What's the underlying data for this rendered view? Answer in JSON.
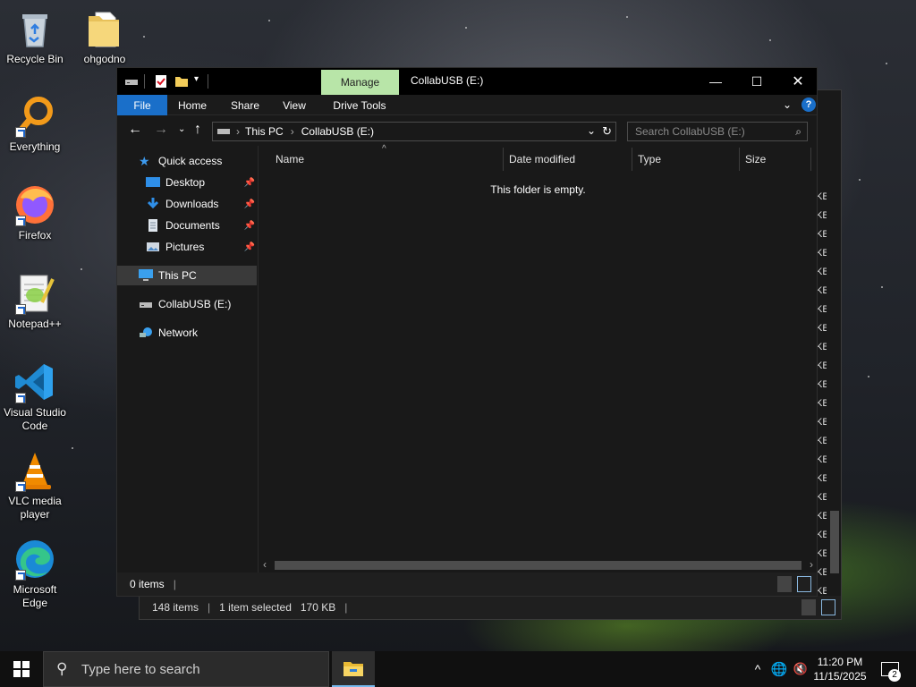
{
  "desktop": {
    "icons": [
      {
        "label": "Recycle Bin",
        "icon": "recycle-bin-icon"
      },
      {
        "label": "ohgodno",
        "icon": "folder-icon"
      },
      {
        "label": "Everything",
        "icon": "everything-search-icon"
      },
      {
        "label": "Firefox",
        "icon": "firefox-icon"
      },
      {
        "label": "Notepad++",
        "icon": "notepad-plus-plus-icon"
      },
      {
        "label": "Visual Studio Code",
        "icon": "vscode-icon"
      },
      {
        "label": "VLC media player",
        "icon": "vlc-icon"
      },
      {
        "label": "Microsoft Edge",
        "icon": "edge-icon"
      }
    ]
  },
  "background_window": {
    "status": {
      "items": "148 items",
      "selected": "1 item selected",
      "size": "170 KB"
    },
    "size_fragment": "KB"
  },
  "explorer": {
    "title": "CollabUSB (E:)",
    "contextual_tab": "Manage",
    "ribbon_tabs": [
      "File",
      "Home",
      "Share",
      "View",
      "Drive Tools"
    ],
    "breadcrumb": [
      "This PC",
      "CollabUSB (E:)"
    ],
    "search_placeholder": "Search CollabUSB (E:)",
    "nav": {
      "quick_access": "Quick access",
      "pinned": [
        "Desktop",
        "Downloads",
        "Documents",
        "Pictures"
      ],
      "this_pc": "This PC",
      "drive": "CollabUSB (E:)",
      "network": "Network"
    },
    "columns": [
      "Name",
      "Date modified",
      "Type",
      "Size"
    ],
    "empty_message": "This folder is empty.",
    "status": {
      "items": "0 items"
    }
  },
  "taskbar": {
    "search_placeholder": "Type here to search",
    "time": "11:20 PM",
    "date": "11/15/2025",
    "notifications": "2"
  },
  "colors": {
    "file_tab": "#1a6fc9",
    "manage_tab": "#b8e5a8",
    "taskbar": "#101010",
    "window_bg": "#191919"
  }
}
